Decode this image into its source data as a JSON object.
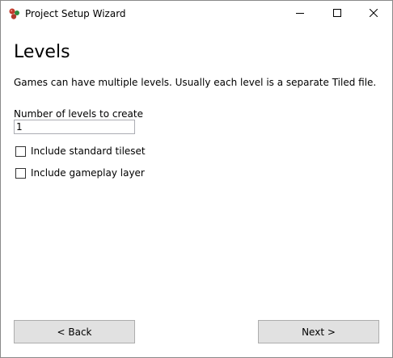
{
  "window": {
    "title": "Project Setup Wizard",
    "app_icon": "app-icon-red-green-dots",
    "controls": [
      "minimize-icon",
      "maximize-icon",
      "close-icon"
    ]
  },
  "page": {
    "title": "Levels",
    "description": "Games can have multiple levels. Usually each level is a separate Tiled file."
  },
  "levels_field": {
    "label": "Number of levels to create",
    "value": "1"
  },
  "options": [
    {
      "label": "Include standard tileset",
      "checked": false
    },
    {
      "label": "Include gameplay layer",
      "checked": false
    }
  ],
  "buttons": {
    "back": "< Back",
    "next": "Next >"
  }
}
